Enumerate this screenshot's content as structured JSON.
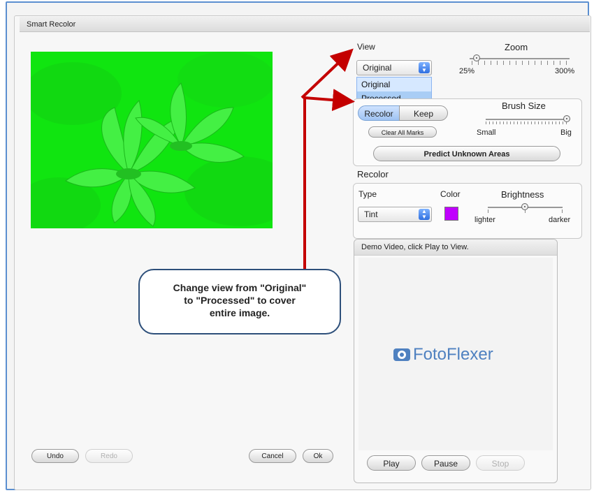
{
  "window": {
    "title": "Smart Recolor"
  },
  "view": {
    "label": "View",
    "selected": "Original",
    "options": [
      "Original",
      "Processed"
    ],
    "highlighted_option": "Processed"
  },
  "zoom": {
    "label": "Zoom",
    "min_label": "25%",
    "max_label": "300%",
    "value_fraction": 0.05
  },
  "marks": {
    "recolor_label": "Recolor",
    "keep_label": "Keep",
    "clear_label": "Clear All Marks",
    "brush_size_label": "Brush Size",
    "brush_small": "Small",
    "brush_big": "Big",
    "brush_value_fraction": 1.0,
    "predict_label": "Predict Unknown Areas"
  },
  "recolor": {
    "section_label": "Recolor",
    "type_label": "Type",
    "type_selected": "Tint",
    "color_label": "Color",
    "color_value": "#c000ff",
    "brightness_label": "Brightness",
    "lighter": "lighter",
    "darker": "darker",
    "brightness_fraction": 0.5
  },
  "video": {
    "title": "Demo Video, click Play to View.",
    "logo_text": "FotoFlexer",
    "play": "Play",
    "pause": "Pause",
    "stop": "Stop"
  },
  "footer": {
    "undo": "Undo",
    "redo": "Redo",
    "cancel": "Cancel",
    "ok": "Ok"
  },
  "callout": {
    "line1": "Change view from \"Original\"",
    "line2": "to \"Processed\" to cover",
    "line3": "entire image."
  },
  "colors": {
    "photo_green": "#0ee70e",
    "arrow_red": "#c40000",
    "frame_blue": "#5b8fd0"
  }
}
